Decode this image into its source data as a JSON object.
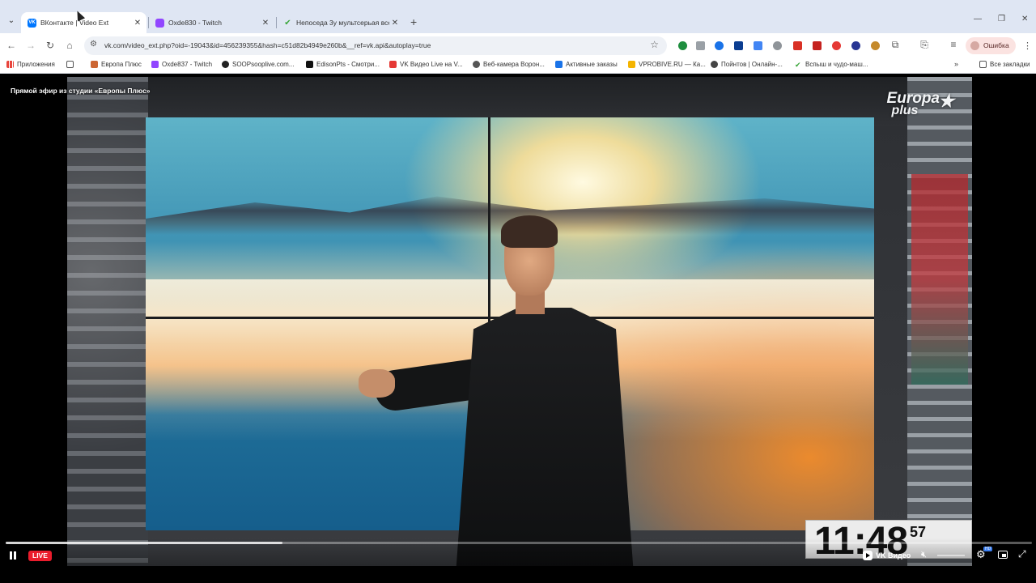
{
  "browser": {
    "tabs": [
      {
        "title": "ВКонтакте | Video Ext",
        "favicon": "vk-icon",
        "active": true
      },
      {
        "title": "Oxde830 - Twitch",
        "favicon": "twitch-icon",
        "active": false
      },
      {
        "title": "Непоседа 3у мультсерьая все",
        "favicon": "check-icon",
        "active": false
      }
    ],
    "url": "vk.com/video_ext.php?oid=-19043&id=456239355&hash=c51d82b4949e260b&__ref=vk.api&autoplay=true",
    "error_label": "Ошибка",
    "bookmarks": [
      "Приложения",
      "Европа Плюс",
      "Oxde837 - Twitch",
      "SOOPsooplive.com...",
      "EdisonPts - Смотри...",
      "VK Видео Live на V...",
      "Веб-камера Ворон...",
      "Активные заказы",
      "VPROBIVE.RU — Ка...",
      "Пойнтов | Онлайн-...",
      "Вспыш и чудо-маш..."
    ],
    "all_bookmarks_label": "Все закладки"
  },
  "player": {
    "title": "Прямой эфир из студии «Европы Плюс»",
    "live_label": "LIVE",
    "brand_label": "VK Видео",
    "progress": 0.27,
    "channel_logo": {
      "line1": "Europa",
      "line2": "plus"
    },
    "clock": {
      "hm": "11:48",
      "sec": "57"
    }
  },
  "colors": {
    "live_red": "#ea1c2c",
    "tabbar_bg": "#dfe6f3",
    "error_pill_bg": "#fbe3e1"
  }
}
